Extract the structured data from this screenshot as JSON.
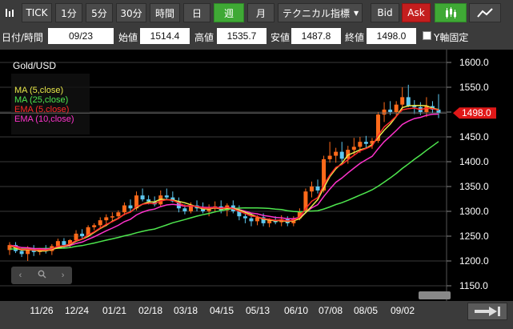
{
  "toolbar": {
    "bars_icon": "bars-icon",
    "tick": "TICK",
    "m1": "1分",
    "m5": "5分",
    "m30": "30分",
    "hour": "時間",
    "day": "日",
    "week": "週",
    "month": "月",
    "technical": "テクニカル指標",
    "bid": "Bid",
    "ask": "Ask",
    "candle_icon": "candlestick-icon",
    "line_icon": "line-chart-icon"
  },
  "ohlc": {
    "datetime_label": "日付/時間",
    "datetime_value": "09/23",
    "open_label": "始値",
    "open_value": "1514.4",
    "high_label": "高値",
    "high_value": "1535.7",
    "low_label": "安値",
    "low_value": "1487.8",
    "close_label": "終値",
    "close_value": "1498.0",
    "yfix_label": "Y軸固定"
  },
  "chart_data": {
    "type": "candlestick",
    "symbol": "Gold/USD",
    "legend": [
      {
        "name": "MA (5,close)",
        "color": "#e8e84a"
      },
      {
        "name": "MA (25,close)",
        "color": "#4ee64e"
      },
      {
        "name": "EMA (5,close)",
        "color": "#ff2a2a"
      },
      {
        "name": "EMA (10,close)",
        "color": "#ff33cc"
      }
    ],
    "y_ticks": [
      "1600.0",
      "1550.0",
      "1500.0",
      "1450.0",
      "1400.0",
      "1350.0",
      "1300.0",
      "1250.0",
      "1200.0",
      "1150.0"
    ],
    "ylim": [
      1150,
      1600
    ],
    "x_ticks": [
      "11/26",
      "12/24",
      "01/21",
      "02/18",
      "03/18",
      "04/15",
      "05/13",
      "06/10",
      "07/08",
      "08/05",
      "09/02"
    ],
    "current_price": "1498.0",
    "candles": [
      {
        "o": 1222,
        "h": 1238,
        "l": 1212,
        "c": 1232
      },
      {
        "o": 1232,
        "h": 1238,
        "l": 1216,
        "c": 1220
      },
      {
        "o": 1220,
        "h": 1228,
        "l": 1208,
        "c": 1214
      },
      {
        "o": 1214,
        "h": 1230,
        "l": 1200,
        "c": 1225
      },
      {
        "o": 1225,
        "h": 1232,
        "l": 1210,
        "c": 1218
      },
      {
        "o": 1218,
        "h": 1226,
        "l": 1212,
        "c": 1224
      },
      {
        "o": 1224,
        "h": 1232,
        "l": 1215,
        "c": 1220
      },
      {
        "o": 1220,
        "h": 1234,
        "l": 1212,
        "c": 1230
      },
      {
        "o": 1230,
        "h": 1245,
        "l": 1226,
        "c": 1240
      },
      {
        "o": 1240,
        "h": 1246,
        "l": 1226,
        "c": 1232
      },
      {
        "o": 1232,
        "h": 1244,
        "l": 1228,
        "c": 1242
      },
      {
        "o": 1242,
        "h": 1262,
        "l": 1240,
        "c": 1255
      },
      {
        "o": 1255,
        "h": 1264,
        "l": 1245,
        "c": 1250
      },
      {
        "o": 1250,
        "h": 1272,
        "l": 1248,
        "c": 1268
      },
      {
        "o": 1268,
        "h": 1276,
        "l": 1262,
        "c": 1272
      },
      {
        "o": 1272,
        "h": 1288,
        "l": 1266,
        "c": 1282
      },
      {
        "o": 1282,
        "h": 1294,
        "l": 1270,
        "c": 1288
      },
      {
        "o": 1288,
        "h": 1298,
        "l": 1278,
        "c": 1290
      },
      {
        "o": 1290,
        "h": 1302,
        "l": 1284,
        "c": 1298
      },
      {
        "o": 1298,
        "h": 1318,
        "l": 1292,
        "c": 1312
      },
      {
        "o": 1312,
        "h": 1324,
        "l": 1300,
        "c": 1306
      },
      {
        "o": 1306,
        "h": 1340,
        "l": 1302,
        "c": 1332
      },
      {
        "o": 1332,
        "h": 1346,
        "l": 1320,
        "c": 1324
      },
      {
        "o": 1324,
        "h": 1332,
        "l": 1314,
        "c": 1320
      },
      {
        "o": 1320,
        "h": 1330,
        "l": 1310,
        "c": 1314
      },
      {
        "o": 1314,
        "h": 1342,
        "l": 1310,
        "c": 1332
      },
      {
        "o": 1332,
        "h": 1346,
        "l": 1324,
        "c": 1328
      },
      {
        "o": 1328,
        "h": 1340,
        "l": 1318,
        "c": 1320
      },
      {
        "o": 1320,
        "h": 1328,
        "l": 1298,
        "c": 1306
      },
      {
        "o": 1306,
        "h": 1314,
        "l": 1294,
        "c": 1300
      },
      {
        "o": 1300,
        "h": 1318,
        "l": 1296,
        "c": 1312
      },
      {
        "o": 1312,
        "h": 1322,
        "l": 1300,
        "c": 1306
      },
      {
        "o": 1306,
        "h": 1318,
        "l": 1296,
        "c": 1300
      },
      {
        "o": 1300,
        "h": 1314,
        "l": 1290,
        "c": 1306
      },
      {
        "o": 1306,
        "h": 1320,
        "l": 1298,
        "c": 1310
      },
      {
        "o": 1310,
        "h": 1322,
        "l": 1296,
        "c": 1302
      },
      {
        "o": 1302,
        "h": 1316,
        "l": 1290,
        "c": 1312
      },
      {
        "o": 1312,
        "h": 1322,
        "l": 1296,
        "c": 1300
      },
      {
        "o": 1300,
        "h": 1312,
        "l": 1282,
        "c": 1290
      },
      {
        "o": 1290,
        "h": 1300,
        "l": 1276,
        "c": 1286
      },
      {
        "o": 1286,
        "h": 1296,
        "l": 1270,
        "c": 1280
      },
      {
        "o": 1280,
        "h": 1292,
        "l": 1272,
        "c": 1288
      },
      {
        "o": 1288,
        "h": 1296,
        "l": 1270,
        "c": 1276
      },
      {
        "o": 1276,
        "h": 1286,
        "l": 1268,
        "c": 1282
      },
      {
        "o": 1282,
        "h": 1290,
        "l": 1274,
        "c": 1278
      },
      {
        "o": 1278,
        "h": 1292,
        "l": 1270,
        "c": 1284
      },
      {
        "o": 1284,
        "h": 1290,
        "l": 1270,
        "c": 1276
      },
      {
        "o": 1276,
        "h": 1290,
        "l": 1270,
        "c": 1286
      },
      {
        "o": 1286,
        "h": 1306,
        "l": 1282,
        "c": 1300
      },
      {
        "o": 1300,
        "h": 1346,
        "l": 1296,
        "c": 1340
      },
      {
        "o": 1340,
        "h": 1360,
        "l": 1328,
        "c": 1350
      },
      {
        "o": 1350,
        "h": 1364,
        "l": 1336,
        "c": 1342
      },
      {
        "o": 1342,
        "h": 1412,
        "l": 1338,
        "c": 1405
      },
      {
        "o": 1405,
        "h": 1440,
        "l": 1398,
        "c": 1412
      },
      {
        "o": 1412,
        "h": 1428,
        "l": 1398,
        "c": 1420
      },
      {
        "o": 1420,
        "h": 1440,
        "l": 1400,
        "c": 1406
      },
      {
        "o": 1406,
        "h": 1432,
        "l": 1396,
        "c": 1424
      },
      {
        "o": 1424,
        "h": 1448,
        "l": 1412,
        "c": 1430
      },
      {
        "o": 1430,
        "h": 1450,
        "l": 1418,
        "c": 1440
      },
      {
        "o": 1440,
        "h": 1452,
        "l": 1428,
        "c": 1436
      },
      {
        "o": 1436,
        "h": 1448,
        "l": 1426,
        "c": 1442
      },
      {
        "o": 1442,
        "h": 1500,
        "l": 1438,
        "c": 1495
      },
      {
        "o": 1495,
        "h": 1520,
        "l": 1480,
        "c": 1505
      },
      {
        "o": 1505,
        "h": 1522,
        "l": 1494,
        "c": 1500
      },
      {
        "o": 1500,
        "h": 1522,
        "l": 1492,
        "c": 1515
      },
      {
        "o": 1515,
        "h": 1550,
        "l": 1504,
        "c": 1530
      },
      {
        "o": 1530,
        "h": 1555,
        "l": 1510,
        "c": 1512
      },
      {
        "o": 1512,
        "h": 1524,
        "l": 1496,
        "c": 1510
      },
      {
        "o": 1510,
        "h": 1520,
        "l": 1494,
        "c": 1500
      },
      {
        "o": 1500,
        "h": 1530,
        "l": 1490,
        "c": 1512
      },
      {
        "o": 1512,
        "h": 1522,
        "l": 1498,
        "c": 1505
      },
      {
        "o": 1505,
        "h": 1536,
        "l": 1488,
        "c": 1498
      }
    ]
  },
  "nav": {
    "prev_icon": "chevron-left-icon",
    "zoom_icon": "magnifier-icon",
    "next_icon": "chevron-right-icon",
    "latest_icon": "jump-to-latest-icon"
  }
}
